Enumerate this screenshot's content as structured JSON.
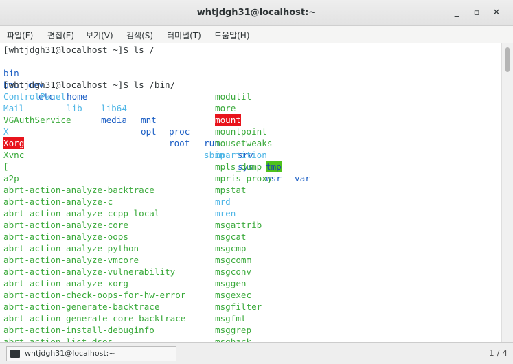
{
  "window": {
    "title": "whtjdgh31@localhost:~",
    "buttons": {
      "minimize": "_",
      "maximize": "▫",
      "close": "✕"
    }
  },
  "menu": [
    "파일(F)",
    "편집(E)",
    "보기(V)",
    "검색(S)",
    "터미널(T)",
    "도움말(H)"
  ],
  "colors": {
    "directory": "#1b5ec4",
    "executable": "#39a93a",
    "symlink": "#4fb6e6",
    "setuid_bg": "#e8141c",
    "sticky_bg": "#4ec21c"
  },
  "terminal": {
    "prompt_1": "[whtjdgh31@localhost ~]$ ls /",
    "root_row_1": [
      "bin",
      "dev",
      "home",
      "lib64",
      "mnt",
      "proc",
      "run",
      "srv",
      "tmp",
      "var"
    ],
    "root_row_2": [
      "boot",
      "etc",
      "lib",
      "media",
      "opt",
      "root",
      "sbin",
      "sys",
      "usr"
    ],
    "prompt_2": "[whtjdgh31@localhost ~]$ ls /bin/",
    "bin_left": [
      "ControlPanel",
      "Mail",
      "VGAuthService",
      "X",
      "Xorg",
      "Xvnc",
      "[",
      "a2p",
      "abrt-action-analyze-backtrace",
      "abrt-action-analyze-c",
      "abrt-action-analyze-ccpp-local",
      "abrt-action-analyze-core",
      "abrt-action-analyze-oops",
      "abrt-action-analyze-python",
      "abrt-action-analyze-vmcore",
      "abrt-action-analyze-vulnerability",
      "abrt-action-analyze-xorg",
      "abrt-action-check-oops-for-hw-error",
      "abrt-action-generate-backtrace",
      "abrt-action-generate-core-backtrace",
      "abrt-action-install-debuginfo",
      "abrt-action-list-dsos"
    ],
    "bin_right": [
      "modutil",
      "more",
      "mount",
      "mountpoint",
      "mousetweaks",
      "mpartition",
      "mpls_dump",
      "mpris-proxy",
      "mpstat",
      "mrd",
      "mren",
      "msgattrib",
      "msgcat",
      "msgcmp",
      "msgcomm",
      "msgconv",
      "msggen",
      "msgexec",
      "msgfilter",
      "msgfmt",
      "msggrep",
      "msghack"
    ]
  },
  "statusbar": {
    "task_label": "whtjdgh31@localhost:~",
    "page": "1 / 4"
  }
}
